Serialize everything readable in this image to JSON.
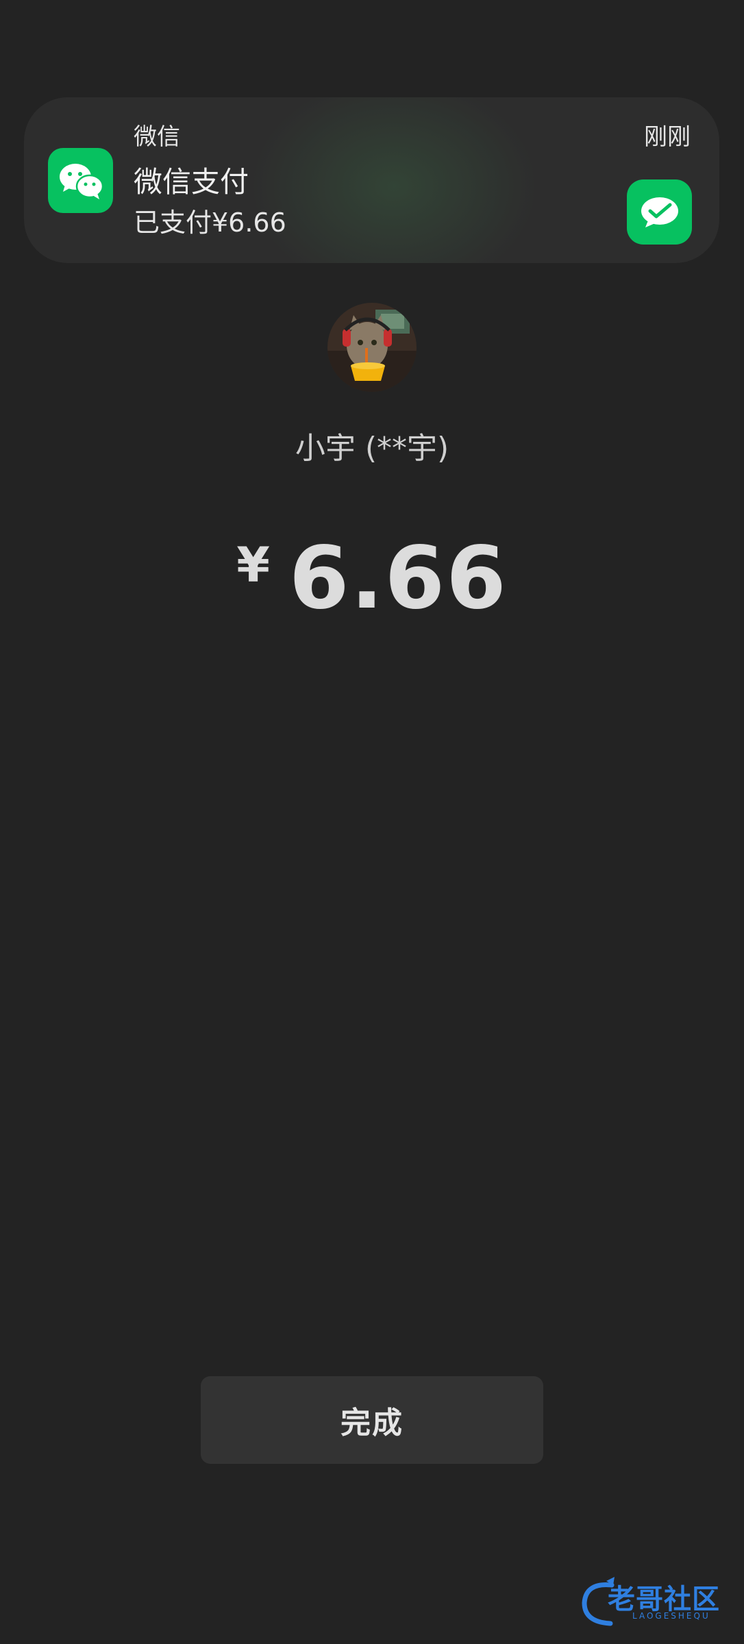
{
  "notification": {
    "app_name": "微信",
    "title": "微信支付",
    "body": "已支付¥6.66",
    "time": "刚刚",
    "app_icon": "wechat-icon",
    "action_icon": "wechat-pay-icon",
    "accent_color": "#07c160"
  },
  "payee": {
    "avatar": "cat-avatar",
    "name": "小宇 (**宇)"
  },
  "payment": {
    "currency_symbol": "¥",
    "amount": "6.66"
  },
  "actions": {
    "done_label": "完成"
  },
  "watermark": {
    "text": "老哥社区",
    "subtext": "LAOGESHEQU"
  },
  "colors": {
    "background": "#232323",
    "banner": "#2d2d2d",
    "button": "#333333",
    "watermark": "#2f7fe0"
  }
}
